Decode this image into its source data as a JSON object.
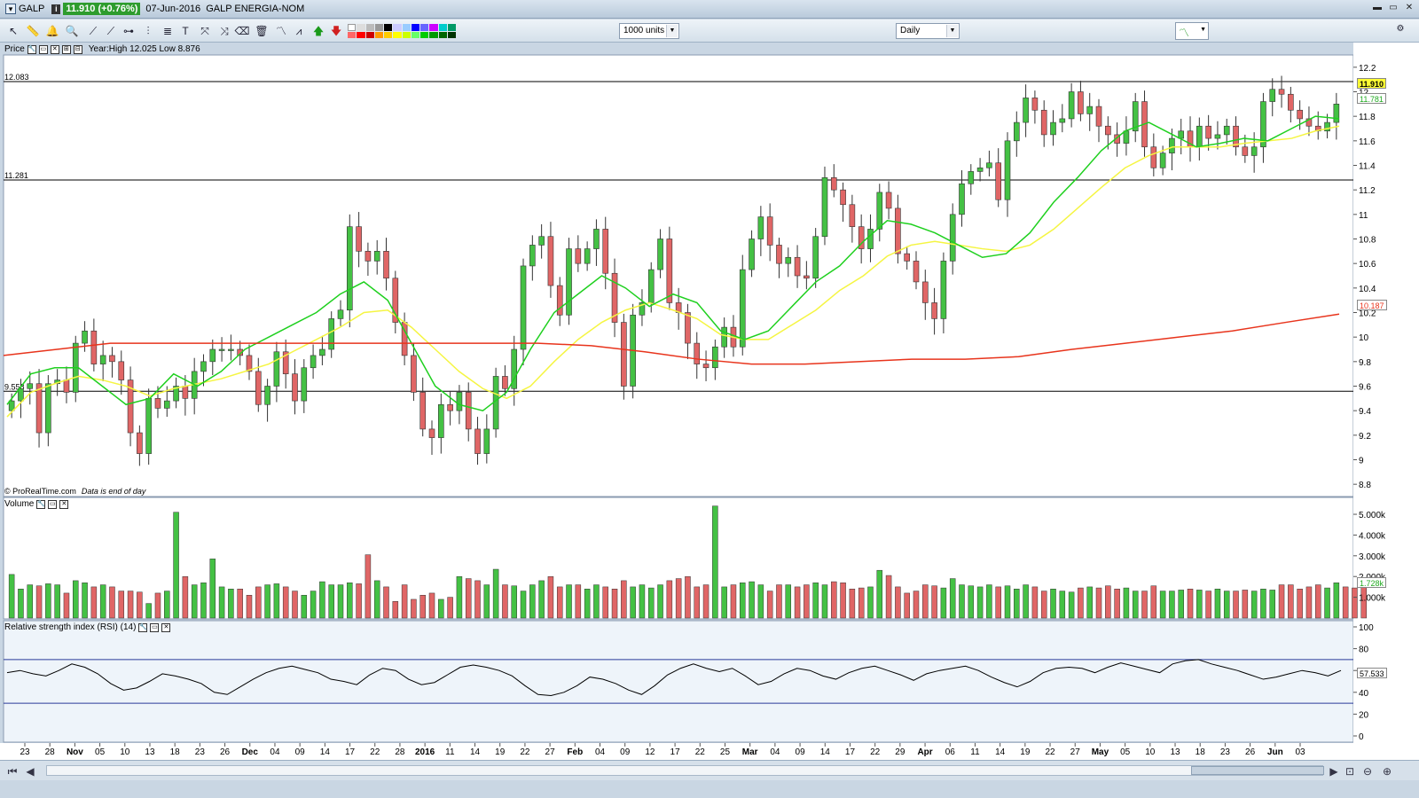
{
  "window": {
    "symbol": "GALP",
    "price_badge": "11.910 (+0.76%)",
    "date": "07-Jun-2016",
    "instrument": "GALP ENERGIA-NOM"
  },
  "toolbar": {
    "units_select": "1000 units",
    "period_select": "Daily"
  },
  "panels": {
    "price": {
      "title": "Price",
      "range_text": "Year:High 12.025 Low 8.876",
      "credit": "© ProRealTime.com",
      "credit_note": "Data is end of day"
    },
    "volume": {
      "title": "Volume"
    },
    "rsi": {
      "title": "Relative strength index (RSI) (14)"
    }
  },
  "right_labels": {
    "last_price": "11.910",
    "ma_short": "11.781",
    "ma_long": "10.187",
    "volume_last": "1.728k",
    "rsi_last": "57.533"
  },
  "hlines": [
    {
      "label": "12.083",
      "value": 12.083
    },
    {
      "label": "11.281",
      "value": 11.281
    },
    {
      "label": "9.558",
      "value": 9.558
    }
  ],
  "colors": {
    "up": "#44c144",
    "down": "#e06666",
    "ma_green": "#1fd01f",
    "ma_yellow": "#f5f542",
    "ma_red": "#e8341c",
    "rsi": "#000000"
  },
  "chart_data": {
    "type": "candlestick",
    "title": "GALP ENERGIA-NOM — Daily",
    "y_axis": {
      "min": 8.7,
      "max": 12.3,
      "ticks": [
        "12.2",
        "12",
        "11.8",
        "11.6",
        "11.4",
        "11.2",
        "11",
        "10.8",
        "10.6",
        "10.4",
        "10.2",
        "10",
        "9.8",
        "9.6",
        "9.4",
        "9.2",
        "9",
        "8.8"
      ]
    },
    "volume_axis_ticks": [
      "5.000k",
      "4.000k",
      "3.000k",
      "2.000k",
      "1.000k"
    ],
    "rsi_axis_ticks": [
      "100",
      "80",
      "60",
      "40",
      "20",
      "0"
    ],
    "rsi_bands": [
      70,
      30
    ],
    "x_labels": [
      "23",
      "28",
      "Nov",
      "05",
      "10",
      "13",
      "18",
      "23",
      "26",
      "Dec",
      "04",
      "09",
      "14",
      "17",
      "22",
      "28",
      "2016",
      "11",
      "14",
      "19",
      "22",
      "27",
      "Feb",
      "04",
      "09",
      "12",
      "17",
      "22",
      "25",
      "Mar",
      "04",
      "09",
      "14",
      "17",
      "22",
      "29",
      "Apr",
      "06",
      "11",
      "14",
      "19",
      "22",
      "27",
      "May",
      "05",
      "10",
      "13",
      "18",
      "23",
      "26",
      "Jun",
      "03"
    ],
    "close": [
      9.48,
      9.58,
      9.62,
      9.22,
      9.62,
      9.65,
      9.55,
      9.95,
      10.05,
      9.78,
      9.85,
      9.8,
      9.65,
      9.22,
      9.05,
      9.5,
      9.42,
      9.48,
      9.6,
      9.5,
      9.72,
      9.8,
      9.9,
      9.9,
      9.9,
      9.85,
      9.72,
      9.45,
      9.6,
      9.88,
      9.7,
      9.48,
      9.75,
      9.85,
      9.9,
      10.15,
      10.22,
      10.9,
      10.7,
      10.62,
      10.7,
      10.48,
      10.12,
      9.85,
      9.55,
      9.25,
      9.18,
      9.45,
      9.4,
      9.55,
      9.25,
      9.05,
      9.25,
      9.68,
      9.58,
      9.9,
      10.58,
      10.75,
      10.82,
      10.42,
      10.18,
      10.72,
      10.6,
      10.72,
      10.88,
      10.52,
      10.12,
      9.6,
      10.18,
      10.28,
      10.55,
      10.8,
      10.28,
      10.2,
      9.95,
      9.78,
      9.75,
      9.92,
      10.08,
      9.92,
      10.55,
      10.8,
      10.98,
      10.75,
      10.6,
      10.65,
      10.5,
      10.48,
      10.82,
      11.3,
      11.2,
      11.08,
      10.9,
      10.72,
      10.88,
      11.18,
      11.05,
      10.68,
      10.62,
      10.45,
      10.28,
      10.15,
      10.62,
      11.0,
      11.25,
      11.35,
      11.38,
      11.42,
      11.12,
      11.6,
      11.75,
      11.95,
      11.85,
      11.65,
      11.75,
      11.78,
      12.0,
      11.82,
      11.88,
      11.72,
      11.65,
      11.58,
      11.68,
      11.92,
      11.55,
      11.38,
      11.5,
      11.62,
      11.68,
      11.55,
      11.72,
      11.62,
      11.65,
      11.72,
      11.55,
      11.48,
      11.55,
      11.92,
      12.02,
      11.98,
      11.85,
      11.78,
      11.72,
      11.68,
      11.75,
      11.9
    ],
    "volume_k": [
      2.1,
      1.4,
      1.6,
      1.55,
      1.65,
      1.6,
      1.2,
      1.8,
      1.7,
      1.5,
      1.6,
      1.5,
      1.3,
      1.3,
      1.25,
      0.7,
      1.2,
      1.3,
      5.1,
      2.0,
      1.6,
      1.7,
      2.85,
      1.5,
      1.4,
      1.4,
      1.1,
      1.5,
      1.6,
      1.65,
      1.5,
      1.3,
      1.1,
      1.3,
      1.75,
      1.6,
      1.6,
      1.7,
      1.65,
      3.05,
      1.8,
      1.5,
      0.8,
      1.6,
      0.9,
      1.1,
      1.2,
      0.9,
      1.0,
      2.0,
      1.9,
      1.8,
      1.6,
      2.35,
      1.6,
      1.55,
      1.3,
      1.6,
      1.8,
      2.0,
      1.5,
      1.6,
      1.6,
      1.4,
      1.6,
      1.5,
      1.4,
      1.8,
      1.5,
      1.6,
      1.45,
      1.6,
      1.8,
      1.9,
      2.0,
      1.5,
      1.6,
      5.4,
      1.5,
      1.6,
      1.7,
      1.75,
      1.6,
      1.3,
      1.6,
      1.6,
      1.5,
      1.6,
      1.7,
      1.6,
      1.75,
      1.7,
      1.4,
      1.45,
      1.5,
      2.3,
      2.05,
      1.5,
      1.2,
      1.3,
      1.6,
      1.55,
      1.45,
      1.9,
      1.6,
      1.55,
      1.5,
      1.6,
      1.5,
      1.55,
      1.4,
      1.6,
      1.5,
      1.3,
      1.4,
      1.3,
      1.25,
      1.45,
      1.5,
      1.45,
      1.55,
      1.4,
      1.45,
      1.3,
      1.3,
      1.55,
      1.3,
      1.3,
      1.35,
      1.4,
      1.35,
      1.3,
      1.4,
      1.3,
      1.3,
      1.35,
      1.3,
      1.4,
      1.35,
      1.6,
      1.6,
      1.4,
      1.5,
      1.6,
      1.45,
      1.7,
      1.5,
      1.45,
      1.6
    ],
    "rsi_samples": [
      58,
      60,
      57,
      55,
      60,
      66,
      63,
      57,
      48,
      42,
      44,
      50,
      57,
      55,
      52,
      48,
      40,
      38,
      45,
      52,
      58,
      62,
      64,
      61,
      58,
      52,
      50,
      47,
      56,
      62,
      60,
      52,
      47,
      49,
      56,
      63,
      65,
      63,
      60,
      55,
      46,
      38,
      37,
      40,
      46,
      54,
      52,
      48,
      42,
      38,
      46,
      56,
      62,
      66,
      62,
      59,
      62,
      55,
      47,
      50,
      57,
      62,
      60,
      55,
      52,
      58,
      62,
      64,
      60,
      56,
      51,
      57,
      60,
      62,
      64,
      60,
      54,
      49,
      45,
      50,
      58,
      62,
      63,
      62,
      58,
      63,
      67,
      64,
      61,
      58,
      66,
      69,
      70,
      66,
      63,
      60,
      56,
      52,
      54,
      57,
      60,
      58,
      55,
      60
    ],
    "ma_green": [
      9.45,
      9.7,
      9.75,
      9.75,
      9.6,
      9.45,
      9.5,
      9.7,
      9.6,
      9.72,
      9.9,
      10.0,
      10.1,
      10.2,
      10.35,
      10.45,
      10.3,
      9.95,
      9.6,
      9.45,
      9.4,
      9.55,
      9.9,
      10.2,
      10.35,
      10.5,
      10.4,
      10.25,
      10.35,
      10.28,
      10.05,
      9.98,
      10.05,
      10.25,
      10.45,
      10.58,
      10.78,
      10.95,
      10.92,
      10.85,
      10.75,
      10.65,
      10.68,
      10.85,
      11.1,
      11.3,
      11.52,
      11.68,
      11.75,
      11.65,
      11.55,
      11.58,
      11.62,
      11.6,
      11.7,
      11.8,
      11.78
    ],
    "ma_yellow": [
      9.35,
      9.55,
      9.62,
      9.68,
      9.65,
      9.6,
      9.52,
      9.58,
      9.62,
      9.66,
      9.72,
      9.78,
      9.88,
      9.98,
      10.08,
      10.2,
      10.22,
      10.08,
      9.9,
      9.72,
      9.58,
      9.5,
      9.6,
      9.8,
      9.98,
      10.12,
      10.22,
      10.28,
      10.22,
      10.15,
      10.02,
      9.98,
      9.98,
      10.1,
      10.22,
      10.38,
      10.5,
      10.66,
      10.75,
      10.78,
      10.75,
      10.72,
      10.7,
      10.75,
      10.88,
      11.05,
      11.22,
      11.38,
      11.48,
      11.55,
      11.55,
      11.55,
      11.58,
      11.6,
      11.62,
      11.68,
      11.72
    ],
    "ma_red": [
      9.85,
      9.9,
      9.95,
      9.95,
      9.95,
      9.95,
      9.95,
      9.95,
      9.95,
      9.95,
      9.95,
      9.93,
      9.88,
      9.82,
      9.78,
      9.78,
      9.8,
      9.82,
      9.82,
      9.84,
      9.9,
      9.95,
      10.0,
      10.05,
      10.12,
      10.187
    ]
  }
}
